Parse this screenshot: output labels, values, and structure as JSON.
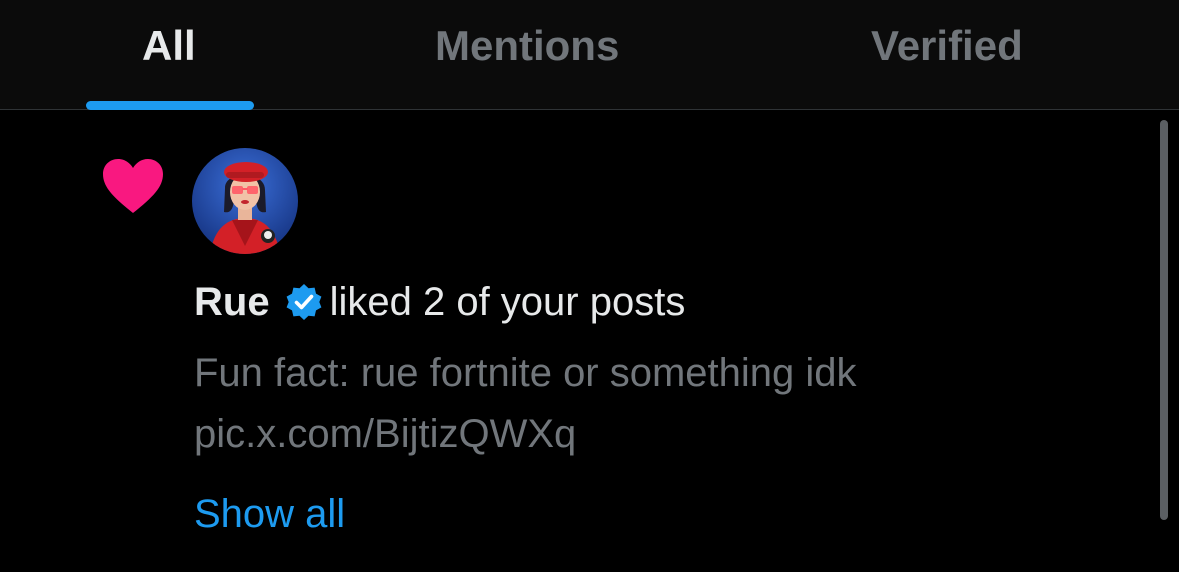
{
  "tabs": [
    {
      "label": "All",
      "active": true
    },
    {
      "label": "Mentions",
      "active": false
    },
    {
      "label": "Verified",
      "active": false
    }
  ],
  "notification": {
    "icon": "heart-icon",
    "icon_color": "#f91880",
    "avatar": "avatar",
    "user_name": "Rue",
    "verified": true,
    "verified_color": "#1d9bf0",
    "action_text": "liked 2 of your posts",
    "post_text_lines": [
      "Fun fact: rue fortnite or something idk",
      "pic.x.com/BijtizQWXq"
    ],
    "show_all_label": "Show all"
  },
  "colors": {
    "accent": "#1d9bf0",
    "like": "#f91880",
    "text_primary": "#e7e9ea",
    "text_secondary": "#71767b"
  }
}
